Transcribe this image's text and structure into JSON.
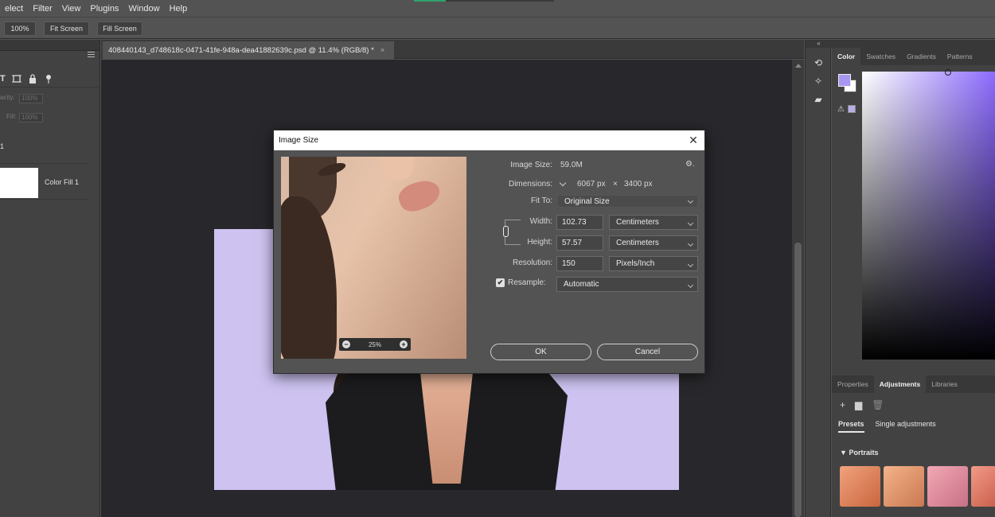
{
  "menu": [
    "elect",
    "Filter",
    "View",
    "Plugins",
    "Window",
    "Help"
  ],
  "options_bar": {
    "zoom_100": "100%",
    "fit_screen": "Fit Screen",
    "fill_screen": "Fill Screen"
  },
  "layers_panel": {
    "opacity_label": "acity:",
    "opacity_value": "100%",
    "fill_label": "Fill:",
    "fill_value": "100%",
    "tool_t": "T",
    "layer1_name": "1",
    "layer2_name": "Color Fill 1"
  },
  "document_tab": {
    "title": "408440143_d748618c-0471-41fe-948a-dea41882639c.psd @ 11.4% (RGB/8) *",
    "close": "×"
  },
  "right_panels": {
    "color_tabs": [
      "Color",
      "Swatches",
      "Gradients",
      "Patterns"
    ],
    "active_color_tab": "Color",
    "foreground_color": "#a896f0",
    "lower_tabs": [
      "Properties",
      "Adjustments",
      "Libraries"
    ],
    "active_lower_tab": "Adjustments",
    "sub_tabs": [
      "Presets",
      "Single adjustments"
    ],
    "portraits_label": "Portraits",
    "toggle": "▼"
  },
  "dialog": {
    "title": "Image Size",
    "close": "✕",
    "image_size_label": "Image Size:",
    "image_size_value": "59.0M",
    "dimensions_label": "Dimensions:",
    "dimensions_w": "6067 px",
    "dimensions_x": "×",
    "dimensions_h": "3400 px",
    "fit_to_label": "Fit To:",
    "fit_to_value": "Original Size",
    "width_label": "Width:",
    "width_value": "102.73",
    "width_unit": "Centimeters",
    "height_label": "Height:",
    "height_value": "57.57",
    "height_unit": "Centimeters",
    "resolution_label": "Resolution:",
    "resolution_value": "150",
    "resolution_unit": "Pixels/Inch",
    "resample_label": "Resample:",
    "resample_checked": "✔",
    "resample_value": "Automatic",
    "preview_zoom": "25%",
    "zoom_out": "−",
    "zoom_in": "+",
    "ok_label": "OK",
    "cancel_label": "Cancel"
  }
}
